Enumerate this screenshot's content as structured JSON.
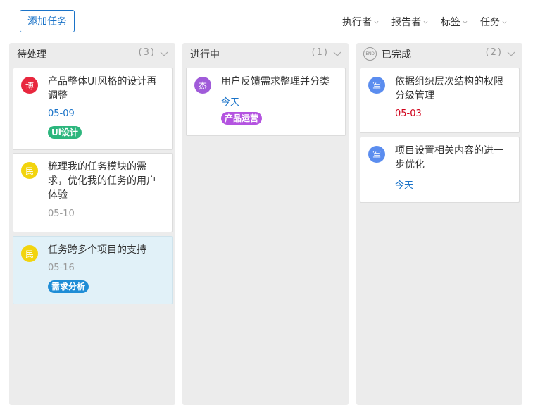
{
  "toolbar": {
    "add_label": "添加任务"
  },
  "filters": [
    {
      "label": "执行者"
    },
    {
      "label": "报告者"
    },
    {
      "label": "标签"
    },
    {
      "label": "任务"
    }
  ],
  "columns": [
    {
      "title": "待处理",
      "count": "(3)",
      "cards": [
        {
          "avatar": "博",
          "avatar_color": "#e8273e",
          "title": "产品整体UI风格的设计再调整",
          "date": "05-09",
          "date_color": "#1a73c8",
          "tag": "Ui设计",
          "tag_color": "#2cb67d"
        },
        {
          "avatar": "民",
          "avatar_color": "#f2d40e",
          "title": "梳理我的任务模块的需求，优化我的任务的用户体验",
          "date": "05-10",
          "date_color": "#999999"
        },
        {
          "avatar": "民",
          "avatar_color": "#f2d40e",
          "title": "任务跨多个项目的支持",
          "date": "05-16",
          "date_color": "#999999",
          "tag": "需求分析",
          "tag_color": "#1f8dd6"
        }
      ]
    },
    {
      "title": "进行中",
      "count": "(1)",
      "cards": [
        {
          "avatar": "杰",
          "avatar_color": "#a05bd9",
          "title": "用户反馈需求整理并分类",
          "date": "今天",
          "date_color": "#1a73c8",
          "tag": "产品运营",
          "tag_color": "#b453e0"
        }
      ]
    },
    {
      "title": "已完成",
      "count": "(2)",
      "end_label": "END",
      "cards": [
        {
          "avatar": "军",
          "avatar_color": "#5b8def",
          "title": "依据组织层次结构的权限分级管理",
          "date": "05-03",
          "date_color": "#d0021b"
        },
        {
          "avatar": "军",
          "avatar_color": "#5b8def",
          "title": "项目设置相关内容的进一步优化",
          "date": "今天",
          "date_color": "#1a73c8"
        }
      ]
    }
  ]
}
